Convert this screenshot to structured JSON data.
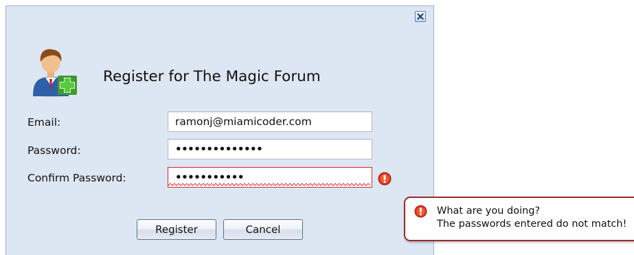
{
  "dialog": {
    "title": "Register for The Magic Forum",
    "close_icon": "close-icon",
    "avatar_icon": "user-add-icon"
  },
  "form": {
    "email_label": "Email:",
    "email_value": "ramonj@miamicoder.com",
    "password_label": "Password:",
    "password_value": "••••••••••••••",
    "confirm_label": "Confirm Password:",
    "confirm_value": "•••••••••••"
  },
  "buttons": {
    "register_label": "Register",
    "cancel_label": "Cancel"
  },
  "error_tooltip": {
    "line1": "What are you doing?",
    "line2": "The passwords entered do not match!",
    "icon": "error-icon"
  },
  "colors": {
    "window_bg": "#dde6f3",
    "error_red": "#cc3333",
    "tooltip_border": "#992b2b"
  }
}
